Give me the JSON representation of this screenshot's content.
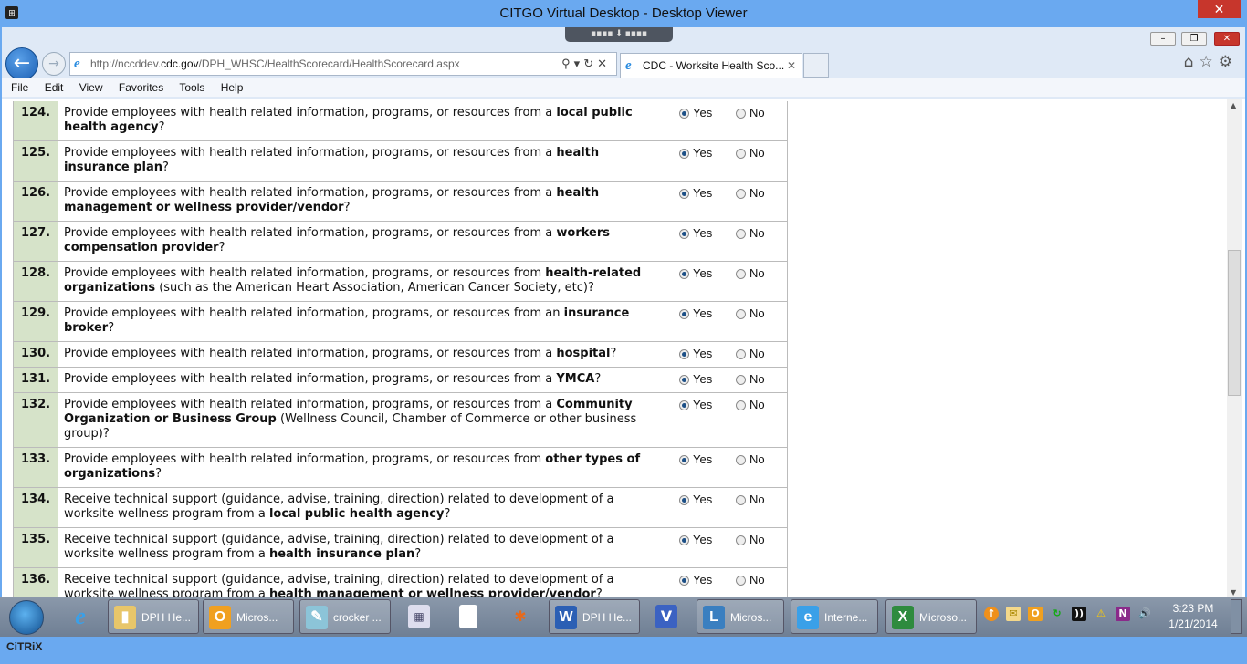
{
  "window": {
    "title": "CITGO Virtual Desktop - Desktop Viewer",
    "close": "✕"
  },
  "browser": {
    "url_prefix": "http://nccddev.",
    "url_domain": "cdc.gov",
    "url_path": "/DPH_WHSC/HealthScorecard/HealthScorecard.aspx",
    "tab_title": "CDC - Worksite Health Sco...",
    "menu": [
      "File",
      "Edit",
      "View",
      "Favorites",
      "Tools",
      "Help"
    ]
  },
  "answer_labels": {
    "yes": "Yes",
    "no": "No"
  },
  "questions": [
    {
      "num": "124.",
      "answer": "yes",
      "parts": [
        {
          "t": "Provide employees with health related information, programs, or resources from a "
        },
        {
          "t": "local public health agency",
          "b": true
        },
        {
          "t": "?"
        }
      ]
    },
    {
      "num": "125.",
      "answer": "yes",
      "parts": [
        {
          "t": "Provide employees with health related information, programs, or resources from a "
        },
        {
          "t": "health insurance plan",
          "b": true
        },
        {
          "t": "?"
        }
      ]
    },
    {
      "num": "126.",
      "answer": "yes",
      "parts": [
        {
          "t": "Provide employees with health related information, programs, or resources from a "
        },
        {
          "t": "health management or wellness provider/vendor",
          "b": true
        },
        {
          "t": "?"
        }
      ]
    },
    {
      "num": "127.",
      "answer": "yes",
      "parts": [
        {
          "t": "Provide employees with health related information, programs, or resources from a "
        },
        {
          "t": "workers compensation provider",
          "b": true
        },
        {
          "t": "?"
        }
      ]
    },
    {
      "num": "128.",
      "answer": "yes",
      "parts": [
        {
          "t": "Provide employees with health related information, programs, or resources from "
        },
        {
          "t": "health-related organizations",
          "b": true
        },
        {
          "t": " (such as the American Heart Association, American Cancer Society, etc)?"
        }
      ]
    },
    {
      "num": "129.",
      "answer": "yes",
      "parts": [
        {
          "t": "Provide employees with health related information, programs, or resources from an "
        },
        {
          "t": "insurance broker",
          "b": true
        },
        {
          "t": "?"
        }
      ]
    },
    {
      "num": "130.",
      "answer": "yes",
      "parts": [
        {
          "t": "Provide employees with health related information, programs, or resources from a "
        },
        {
          "t": "hospital",
          "b": true
        },
        {
          "t": "?"
        }
      ]
    },
    {
      "num": "131.",
      "answer": "yes",
      "parts": [
        {
          "t": "Provide employees with health related information, programs, or resources from a "
        },
        {
          "t": "YMCA",
          "b": true
        },
        {
          "t": "?"
        }
      ]
    },
    {
      "num": "132.",
      "answer": "yes",
      "parts": [
        {
          "t": "Provide employees with health related information, programs, or resources from a "
        },
        {
          "t": "Community Organization or Business Group",
          "b": true
        },
        {
          "t": " (Wellness Council, Chamber of Commerce or other business group)?"
        }
      ]
    },
    {
      "num": "133.",
      "answer": "yes",
      "parts": [
        {
          "t": "Provide employees with health related information, programs, or resources from "
        },
        {
          "t": "other types of organizations",
          "b": true
        },
        {
          "t": "?"
        }
      ]
    },
    {
      "num": "134.",
      "answer": "yes",
      "parts": [
        {
          "t": "Receive technical support (guidance, advise, training, direction) related to development of a worksite wellness program from a "
        },
        {
          "t": "local public health agency",
          "b": true
        },
        {
          "t": "?"
        }
      ]
    },
    {
      "num": "135.",
      "answer": "yes",
      "parts": [
        {
          "t": "Receive technical support (guidance, advise, training, direction) related to development of a worksite wellness program from a "
        },
        {
          "t": "health insurance plan",
          "b": true
        },
        {
          "t": "?"
        }
      ]
    },
    {
      "num": "136.",
      "answer": "yes",
      "parts": [
        {
          "t": "Receive technical support (guidance, advise, training, direction) related to development of a worksite wellness program from a "
        },
        {
          "t": "health management or wellness provider/vendor",
          "b": true
        },
        {
          "t": "?"
        }
      ]
    }
  ],
  "taskbar": {
    "items": [
      {
        "label": "DPH He...",
        "icon": "folder-icon",
        "color": "#e8c66a",
        "g": "▮"
      },
      {
        "label": "Micros...",
        "icon": "outlook-icon",
        "color": "#f0a020",
        "g": "O"
      },
      {
        "label": "crocker ...",
        "icon": "notepad-icon",
        "color": "#8cc4d8",
        "g": "✎"
      },
      {
        "label": "DPH He...",
        "icon": "word-icon",
        "color": "#2b5fb4",
        "g": "W"
      },
      {
        "label": "Micros...",
        "icon": "lync-icon",
        "color": "#3a7fc0",
        "g": "L"
      },
      {
        "label": "Interne...",
        "icon": "ie-icon",
        "color": "#3aa0e8",
        "g": "e"
      },
      {
        "label": "Microso...",
        "icon": "excel-icon",
        "color": "#2e8b3e",
        "g": "X"
      }
    ],
    "time": "3:23 PM",
    "date": "1/21/2014"
  },
  "footer_logo": "CITRIX"
}
